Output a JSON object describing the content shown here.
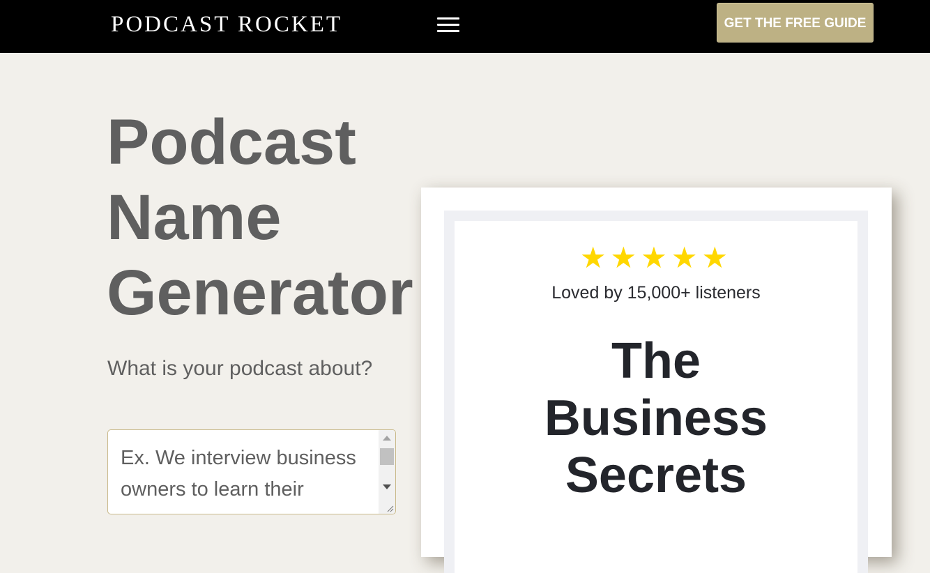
{
  "header": {
    "logo_text": "PODCAST ROCKET",
    "menu_icon": "hamburger-menu-icon",
    "cta_label": "GET THE FREE GUIDE"
  },
  "hero": {
    "title_lines": [
      "Podcast",
      "Name",
      "Generator"
    ],
    "prompt_label": "What is your podcast about?",
    "textarea": {
      "placeholder": "Ex. We interview business owners to learn their secrets to success",
      "value": ""
    }
  },
  "promo_card": {
    "rating_stars": 5,
    "stars_text": "★★★★★",
    "rating_text": "Loved by 15,000+ listeners",
    "title_lines": [
      "The",
      "Business",
      "Secrets"
    ]
  },
  "colors": {
    "topbar": "#000000",
    "page_background": "#f2f0eb",
    "cta_background": "#bdb184",
    "heading_gray": "#5f5f5f",
    "star_yellow": "#ffd700",
    "card_text": "#23252b",
    "textarea_border": "#c9b98a"
  }
}
